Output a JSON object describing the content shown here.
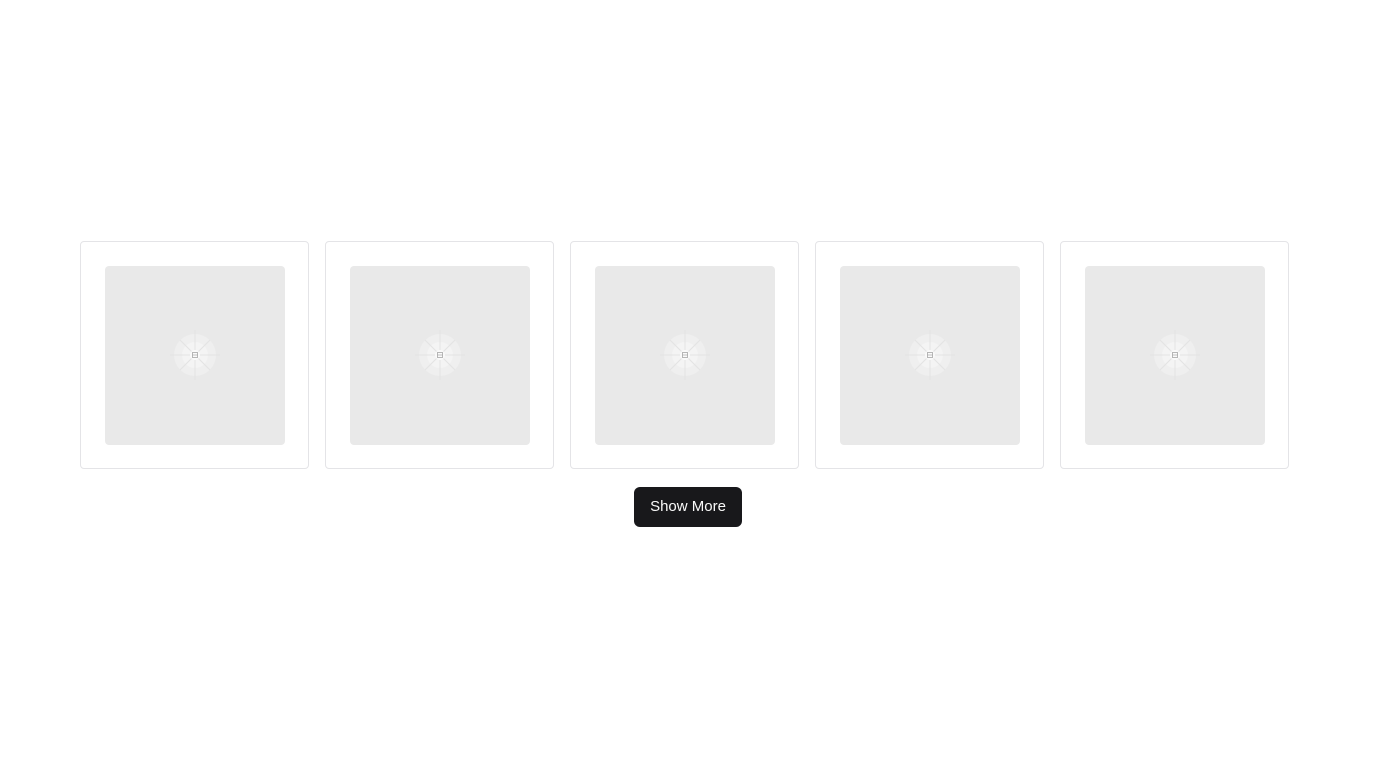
{
  "gallery": {
    "cards": [
      {
        "image_icon": "image-placeholder-icon"
      },
      {
        "image_icon": "image-placeholder-icon"
      },
      {
        "image_icon": "image-placeholder-icon"
      },
      {
        "image_icon": "image-placeholder-icon"
      },
      {
        "image_icon": "image-placeholder-icon"
      }
    ]
  },
  "actions": {
    "show_more_label": "Show More"
  },
  "colors": {
    "button_background": "#18181b",
    "button_text": "#fafafa",
    "placeholder_background": "#e9e9e9",
    "card_border": "#e4e4e7"
  }
}
